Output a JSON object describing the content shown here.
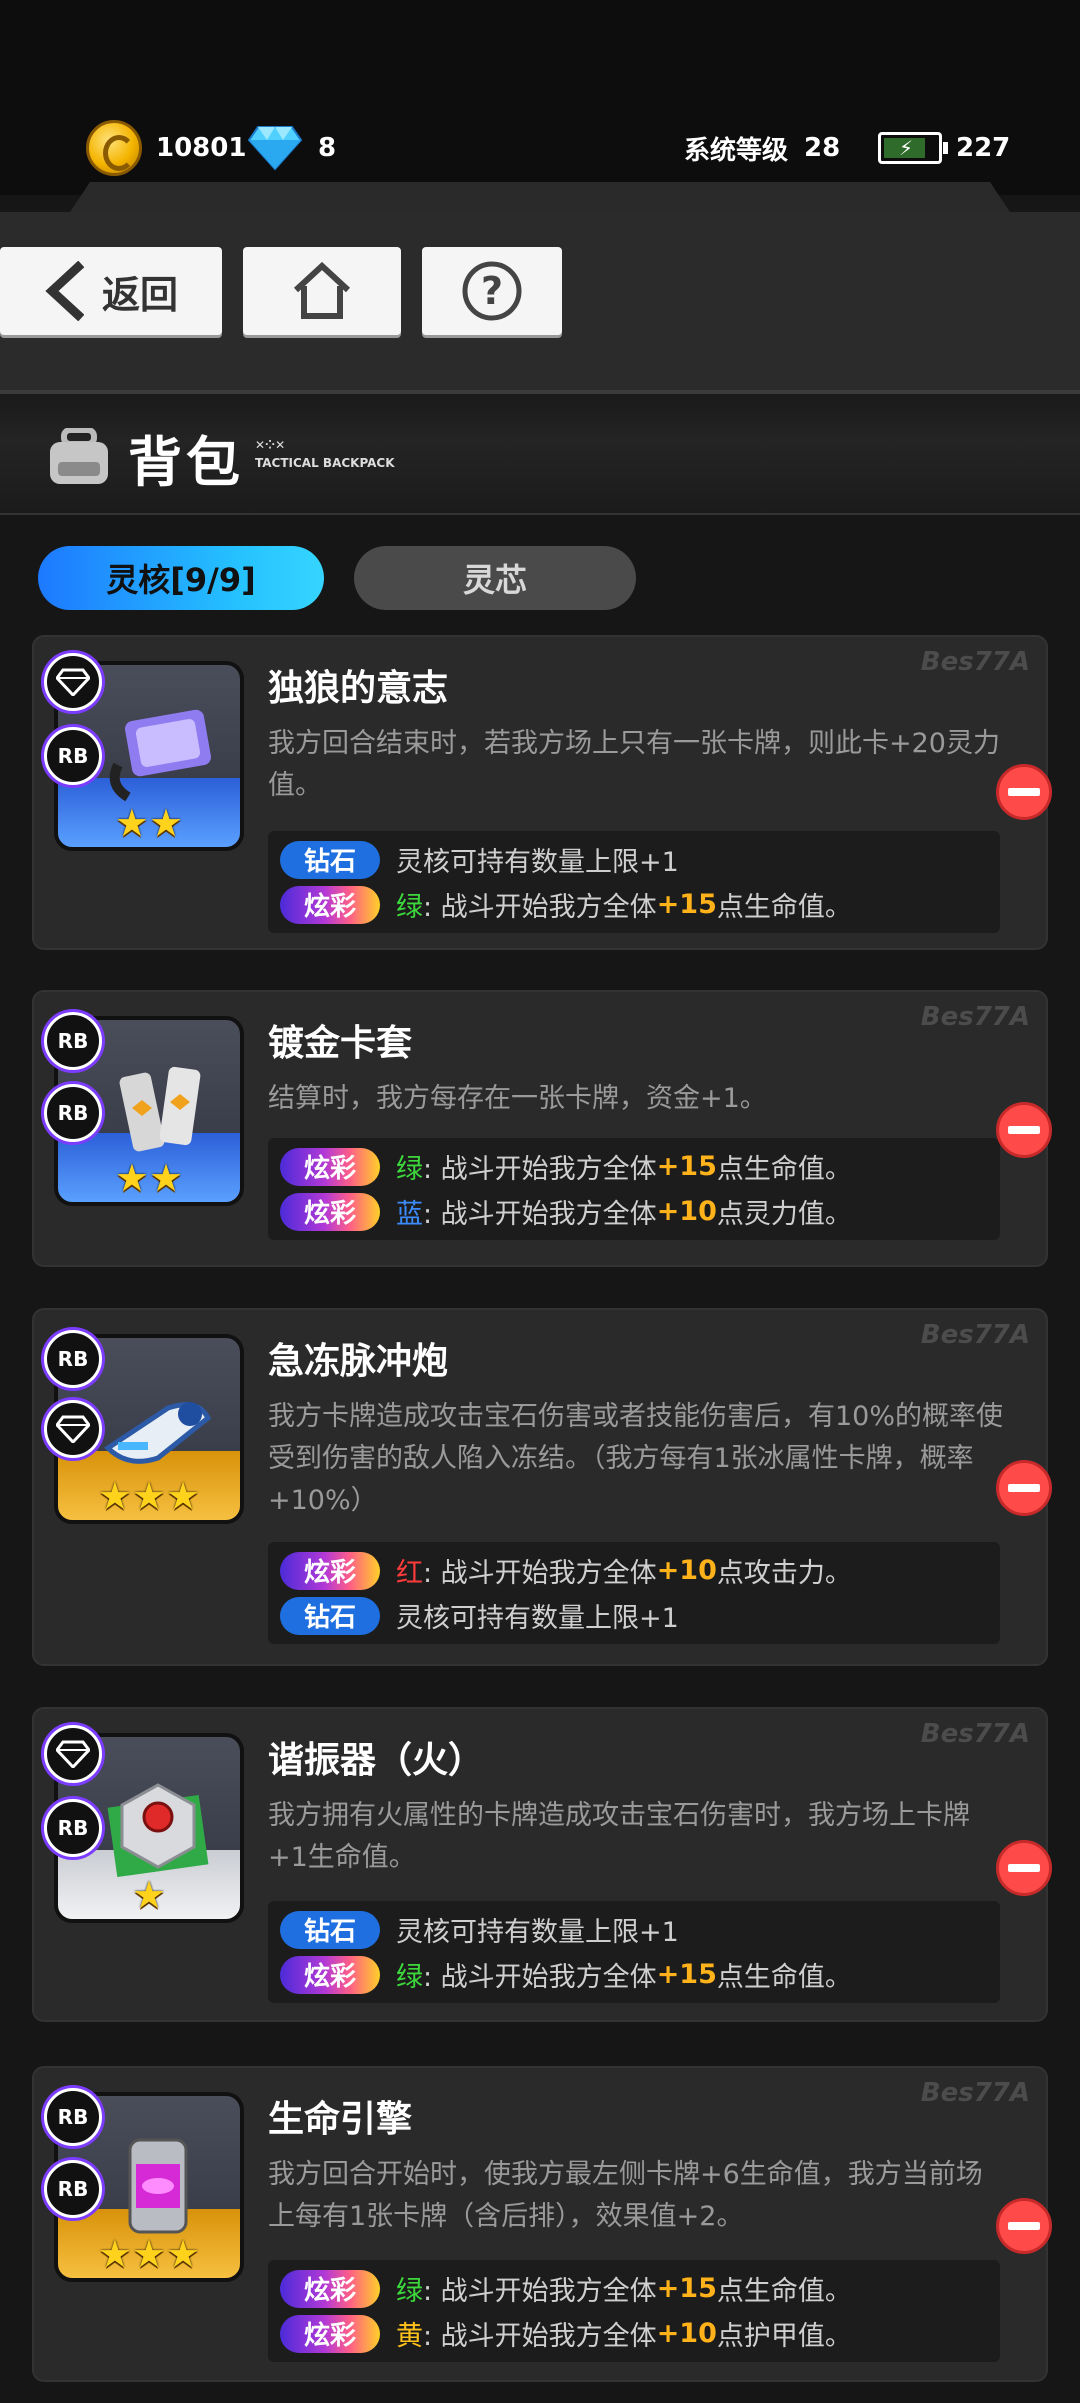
{
  "status": {
    "coins": "10801",
    "diamonds": "8",
    "system_level_label": "系统等级",
    "system_level": "28",
    "energy": "227"
  },
  "nav": {
    "back_label": "返回",
    "home_icon": "home-icon",
    "help_icon": "help-icon"
  },
  "header": {
    "title": "背包",
    "subtitle_line1": "✕⁘✕",
    "subtitle_line2": "TACTICAL BACKPACK"
  },
  "tabs": [
    {
      "label": "灵核[9/9]",
      "active": true
    },
    {
      "label": "灵芯",
      "active": false
    }
  ],
  "watermark": "Bes77A",
  "cards": [
    {
      "name": "独狼的意志",
      "desc": "我方回合结束时，若我方场上只有一张卡牌，则此卡+20灵力值。",
      "stars": "★★",
      "badges": [
        "diamond",
        "RB"
      ],
      "bonuses": [
        {
          "tag": "钻石",
          "type": "diamond",
          "color_word": "",
          "pre": "灵核可持有数量上限+1",
          "num": "",
          "post": ""
        },
        {
          "tag": "炫彩",
          "type": "flashy",
          "color_word": "绿",
          "pre": ": 战斗开始我方全体",
          "num": "+15",
          "post": "点生命值。"
        }
      ]
    },
    {
      "name": "镀金卡套",
      "desc": "结算时，我方每存在一张卡牌，资金+1。",
      "stars": "★★",
      "badges": [
        "RB",
        "RB"
      ],
      "bonuses": [
        {
          "tag": "炫彩",
          "type": "flashy",
          "color_word": "绿",
          "pre": ": 战斗开始我方全体",
          "num": "+15",
          "post": "点生命值。"
        },
        {
          "tag": "炫彩",
          "type": "flashy",
          "color_word": "蓝",
          "pre": ": 战斗开始我方全体",
          "num": "+10",
          "post": "点灵力值。"
        }
      ]
    },
    {
      "name": "急冻脉冲炮",
      "desc": "我方卡牌造成攻击宝石伤害或者技能伤害后，有10%的概率使受到伤害的敌人陷入冻结。（我方每有1张冰属性卡牌，概率+10%）",
      "stars": "★★★",
      "badges": [
        "RB",
        "diamond"
      ],
      "bonuses": [
        {
          "tag": "炫彩",
          "type": "flashy",
          "color_word": "红",
          "pre": ": 战斗开始我方全体",
          "num": "+10",
          "post": "点攻击力。"
        },
        {
          "tag": "钻石",
          "type": "diamond",
          "color_word": "",
          "pre": "灵核可持有数量上限+1",
          "num": "",
          "post": ""
        }
      ]
    },
    {
      "name": "谐振器（火）",
      "desc": "我方拥有火属性的卡牌造成攻击宝石伤害时，我方场上卡牌+1生命值。",
      "stars": "★",
      "badges": [
        "diamond",
        "RB"
      ],
      "bonuses": [
        {
          "tag": "钻石",
          "type": "diamond",
          "color_word": "",
          "pre": "灵核可持有数量上限+1",
          "num": "",
          "post": ""
        },
        {
          "tag": "炫彩",
          "type": "flashy",
          "color_word": "绿",
          "pre": ": 战斗开始我方全体",
          "num": "+15",
          "post": "点生命值。"
        }
      ]
    },
    {
      "name": "生命引擎",
      "desc": "我方回合开始时，使我方最左侧卡牌+6生命值，我方当前场上每有1张卡牌（含后排），效果值+2。",
      "stars": "★★★",
      "badges": [
        "RB",
        "RB"
      ],
      "bonuses": [
        {
          "tag": "炫彩",
          "type": "flashy",
          "color_word": "绿",
          "pre": ": 战斗开始我方全体",
          "num": "+15",
          "post": "点生命值。"
        },
        {
          "tag": "炫彩",
          "type": "flashy",
          "color_word": "黄",
          "pre": ": 战斗开始我方全体",
          "num": "+10",
          "post": "点护甲值。"
        }
      ]
    }
  ]
}
